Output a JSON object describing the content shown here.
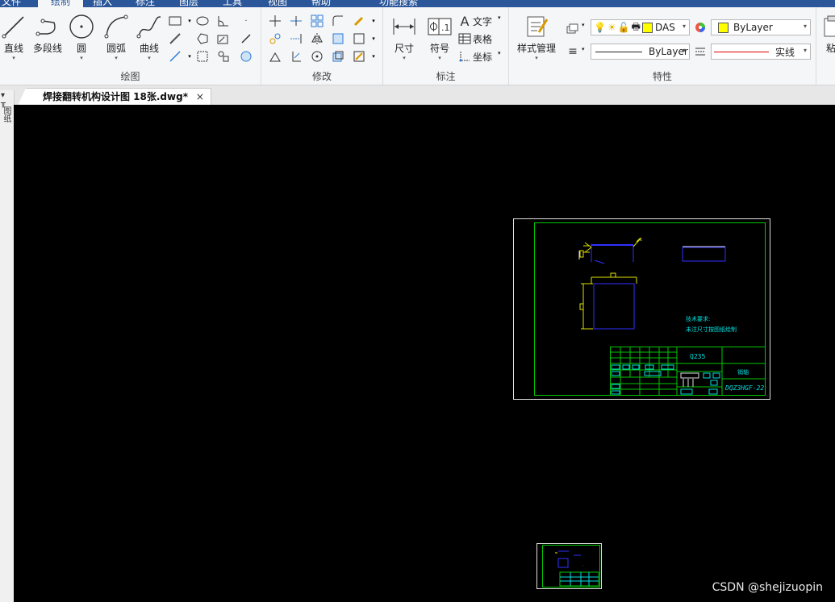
{
  "ribbon_tabs": [
    "文件",
    "绘制",
    "插入",
    "标注",
    "图层",
    "工具",
    "视图",
    "帮助",
    "功能搜索"
  ],
  "groups": {
    "draw": {
      "title": "绘图",
      "line_label": "直线",
      "polyline_label": "多段线",
      "circle_label": "圆",
      "arc_label": "圆弧",
      "curve_label": "曲线"
    },
    "modify": {
      "title": "修改"
    },
    "annotate": {
      "title": "标注",
      "dimension_label": "尺寸",
      "symbol_label": "符号",
      "text_label": "文字",
      "table_label": "表格",
      "coord_label": "坐标"
    },
    "properties": {
      "title": "特性",
      "style_manager_label": "样式管理",
      "layer_value": "DAS",
      "color_value": "ByLayer",
      "linetype_value": "ByLayer",
      "lineweight_value": "实线"
    },
    "clipboard": {
      "paste_label": "粘"
    }
  },
  "document_tab": {
    "title": "焊接翻转机构设计图 18张.dwg*",
    "close_glyph": "×"
  },
  "left_strip": {
    "label": "图纸"
  },
  "drawing": {
    "material_text": "Q235",
    "note_line1": "技术要求:",
    "note_line2": "未注尺寸按图纸绘制",
    "part_name": "销轴",
    "drawing_number": "DQZ3HGF-22"
  },
  "watermark": "CSDN @shejizuopin",
  "colors": {
    "canvas": "#000000",
    "frame_green": "#00c800",
    "part_blue": "#3030ff",
    "dim_yellow": "#e0e000",
    "text_cyan": "#00e0e0",
    "ribbon_blue": "#2b579a"
  }
}
